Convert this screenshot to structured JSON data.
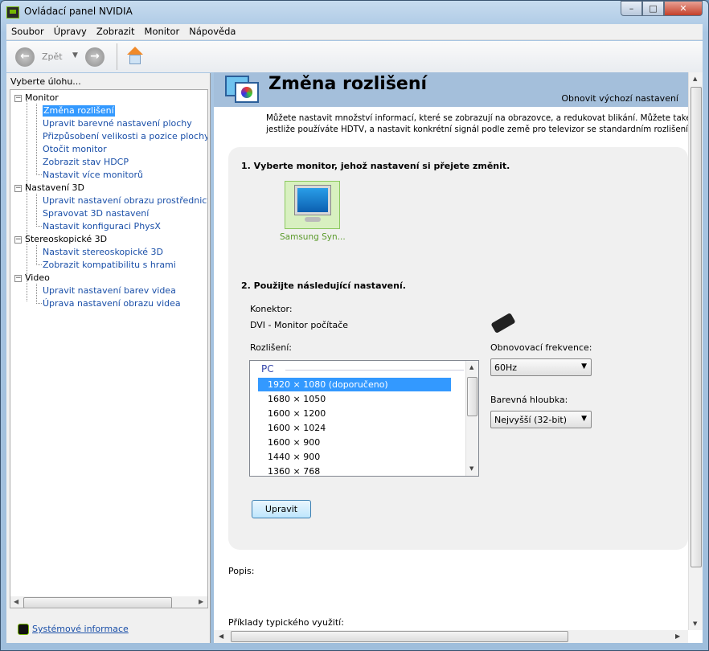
{
  "window": {
    "title": "Ovládací panel NVIDIA",
    "minimize": "–",
    "maximize": "□",
    "close": "✕"
  },
  "menu": [
    "Soubor",
    "Úpravy",
    "Zobrazit",
    "Monitor",
    "Nápověda"
  ],
  "toolbar": {
    "back_label": "Zpět"
  },
  "sidebar": {
    "heading": "Vyberte úlohu...",
    "categories": [
      {
        "label": "Monitor",
        "items": [
          "Změna rozlišení",
          "Upravit barevné nastavení plochy",
          "Přizpůsobení velikosti a pozice plochy",
          "Otočit monitor",
          "Zobrazit stav HDCP",
          "Nastavit více monitorů"
        ]
      },
      {
        "label": "Nastavení 3D",
        "items": [
          "Upravit nastavení obrazu prostřednictvím n",
          "Spravovat 3D nastavení",
          "Nastavit konfiguraci PhysX"
        ]
      },
      {
        "label": "Stereoskopické 3D",
        "items": [
          "Nastavit stereoskopické 3D",
          "Zobrazit kompatibilitu s hrami"
        ]
      },
      {
        "label": "Video",
        "items": [
          "Upravit nastavení barev videa",
          "Úprava nastavení obrazu videa"
        ]
      }
    ],
    "selected": "Změna rozlišení",
    "system_info": "Systémové informace"
  },
  "main": {
    "title": "Změna rozlišení",
    "restore_defaults": "Obnovit výchozí nastavení",
    "description_line1": "Můžete nastavit množství informací, které se zobrazují na obrazovce, a redukovat blikání. Můžete také vybrat t",
    "description_line2": "jestliže používáte HDTV, a nastavit konkrétní signál podle země pro televizor se standardním rozlišením (SD).",
    "step1": "1. Vyberte monitor, jehož nastavení si přejete změnit.",
    "monitor_name": "Samsung Syn...",
    "step2": "2. Použijte následující nastavení.",
    "connector_label": "Konektor:",
    "connector_value": "DVI - Monitor počítače",
    "resolution_label": "Rozlišení:",
    "resolution_group": "PC",
    "resolutions": [
      "1920 × 1080 (doporučeno)",
      "1680 × 1050",
      "1600 × 1200",
      "1600 × 1024",
      "1600 × 900",
      "1440 × 900",
      "1360 × 768"
    ],
    "selected_resolution": "1920 × 1080 (doporučeno)",
    "refresh_label": "Obnovovací frekvence:",
    "refresh_value": "60Hz",
    "depth_label": "Barevná hloubka:",
    "depth_value": "Nejvyšší (32-bit)",
    "apply_button": "Upravit",
    "description_heading": "Popis:",
    "examples_heading": "Příklady typického využití:"
  }
}
